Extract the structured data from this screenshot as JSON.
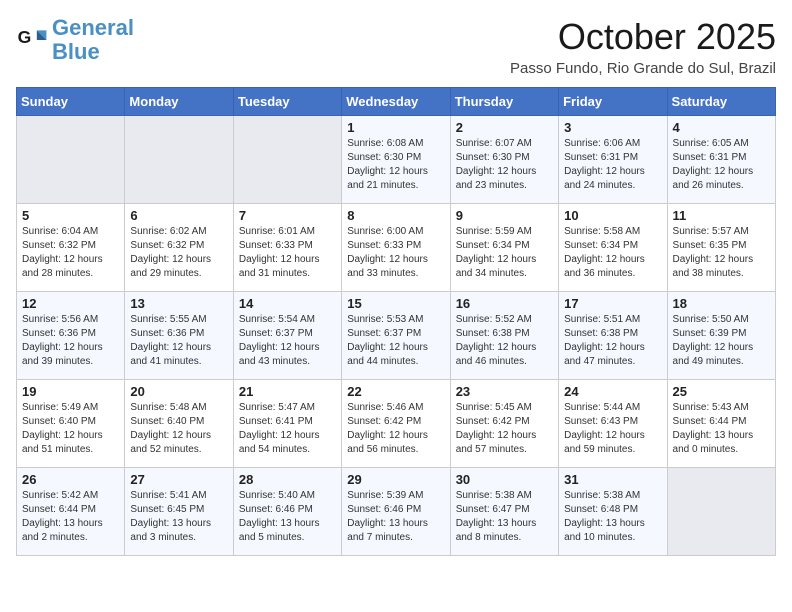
{
  "header": {
    "logo_text_general": "General",
    "logo_text_blue": "Blue",
    "month_title": "October 2025",
    "location": "Passo Fundo, Rio Grande do Sul, Brazil"
  },
  "days_of_week": [
    "Sunday",
    "Monday",
    "Tuesday",
    "Wednesday",
    "Thursday",
    "Friday",
    "Saturday"
  ],
  "weeks": [
    [
      {
        "day": "",
        "content": ""
      },
      {
        "day": "",
        "content": ""
      },
      {
        "day": "",
        "content": ""
      },
      {
        "day": "1",
        "content": "Sunrise: 6:08 AM\nSunset: 6:30 PM\nDaylight: 12 hours\nand 21 minutes."
      },
      {
        "day": "2",
        "content": "Sunrise: 6:07 AM\nSunset: 6:30 PM\nDaylight: 12 hours\nand 23 minutes."
      },
      {
        "day": "3",
        "content": "Sunrise: 6:06 AM\nSunset: 6:31 PM\nDaylight: 12 hours\nand 24 minutes."
      },
      {
        "day": "4",
        "content": "Sunrise: 6:05 AM\nSunset: 6:31 PM\nDaylight: 12 hours\nand 26 minutes."
      }
    ],
    [
      {
        "day": "5",
        "content": "Sunrise: 6:04 AM\nSunset: 6:32 PM\nDaylight: 12 hours\nand 28 minutes."
      },
      {
        "day": "6",
        "content": "Sunrise: 6:02 AM\nSunset: 6:32 PM\nDaylight: 12 hours\nand 29 minutes."
      },
      {
        "day": "7",
        "content": "Sunrise: 6:01 AM\nSunset: 6:33 PM\nDaylight: 12 hours\nand 31 minutes."
      },
      {
        "day": "8",
        "content": "Sunrise: 6:00 AM\nSunset: 6:33 PM\nDaylight: 12 hours\nand 33 minutes."
      },
      {
        "day": "9",
        "content": "Sunrise: 5:59 AM\nSunset: 6:34 PM\nDaylight: 12 hours\nand 34 minutes."
      },
      {
        "day": "10",
        "content": "Sunrise: 5:58 AM\nSunset: 6:34 PM\nDaylight: 12 hours\nand 36 minutes."
      },
      {
        "day": "11",
        "content": "Sunrise: 5:57 AM\nSunset: 6:35 PM\nDaylight: 12 hours\nand 38 minutes."
      }
    ],
    [
      {
        "day": "12",
        "content": "Sunrise: 5:56 AM\nSunset: 6:36 PM\nDaylight: 12 hours\nand 39 minutes."
      },
      {
        "day": "13",
        "content": "Sunrise: 5:55 AM\nSunset: 6:36 PM\nDaylight: 12 hours\nand 41 minutes."
      },
      {
        "day": "14",
        "content": "Sunrise: 5:54 AM\nSunset: 6:37 PM\nDaylight: 12 hours\nand 43 minutes."
      },
      {
        "day": "15",
        "content": "Sunrise: 5:53 AM\nSunset: 6:37 PM\nDaylight: 12 hours\nand 44 minutes."
      },
      {
        "day": "16",
        "content": "Sunrise: 5:52 AM\nSunset: 6:38 PM\nDaylight: 12 hours\nand 46 minutes."
      },
      {
        "day": "17",
        "content": "Sunrise: 5:51 AM\nSunset: 6:38 PM\nDaylight: 12 hours\nand 47 minutes."
      },
      {
        "day": "18",
        "content": "Sunrise: 5:50 AM\nSunset: 6:39 PM\nDaylight: 12 hours\nand 49 minutes."
      }
    ],
    [
      {
        "day": "19",
        "content": "Sunrise: 5:49 AM\nSunset: 6:40 PM\nDaylight: 12 hours\nand 51 minutes."
      },
      {
        "day": "20",
        "content": "Sunrise: 5:48 AM\nSunset: 6:40 PM\nDaylight: 12 hours\nand 52 minutes."
      },
      {
        "day": "21",
        "content": "Sunrise: 5:47 AM\nSunset: 6:41 PM\nDaylight: 12 hours\nand 54 minutes."
      },
      {
        "day": "22",
        "content": "Sunrise: 5:46 AM\nSunset: 6:42 PM\nDaylight: 12 hours\nand 56 minutes."
      },
      {
        "day": "23",
        "content": "Sunrise: 5:45 AM\nSunset: 6:42 PM\nDaylight: 12 hours\nand 57 minutes."
      },
      {
        "day": "24",
        "content": "Sunrise: 5:44 AM\nSunset: 6:43 PM\nDaylight: 12 hours\nand 59 minutes."
      },
      {
        "day": "25",
        "content": "Sunrise: 5:43 AM\nSunset: 6:44 PM\nDaylight: 13 hours\nand 0 minutes."
      }
    ],
    [
      {
        "day": "26",
        "content": "Sunrise: 5:42 AM\nSunset: 6:44 PM\nDaylight: 13 hours\nand 2 minutes."
      },
      {
        "day": "27",
        "content": "Sunrise: 5:41 AM\nSunset: 6:45 PM\nDaylight: 13 hours\nand 3 minutes."
      },
      {
        "day": "28",
        "content": "Sunrise: 5:40 AM\nSunset: 6:46 PM\nDaylight: 13 hours\nand 5 minutes."
      },
      {
        "day": "29",
        "content": "Sunrise: 5:39 AM\nSunset: 6:46 PM\nDaylight: 13 hours\nand 7 minutes."
      },
      {
        "day": "30",
        "content": "Sunrise: 5:38 AM\nSunset: 6:47 PM\nDaylight: 13 hours\nand 8 minutes."
      },
      {
        "day": "31",
        "content": "Sunrise: 5:38 AM\nSunset: 6:48 PM\nDaylight: 13 hours\nand 10 minutes."
      },
      {
        "day": "",
        "content": ""
      }
    ]
  ]
}
